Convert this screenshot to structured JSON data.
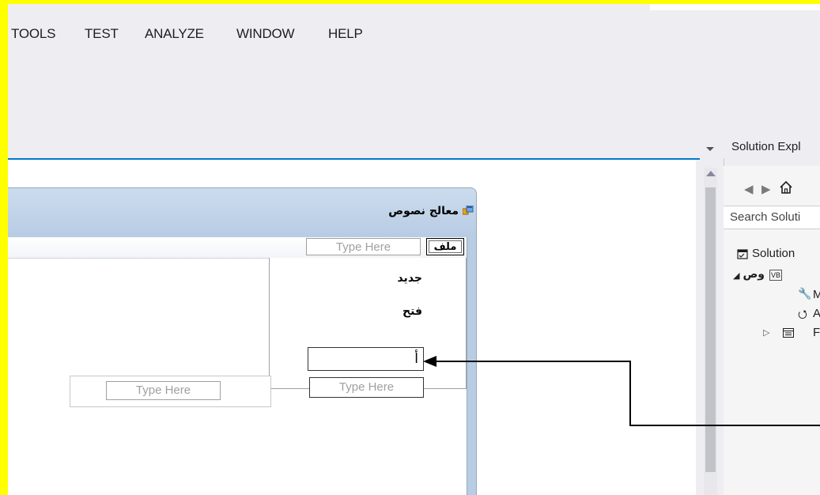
{
  "menu": {
    "items": [
      "TOOLS",
      "TEST",
      "ANALYZE",
      "WINDOW",
      "HELP"
    ]
  },
  "form": {
    "title": "معالج نصوص",
    "menu_file": "ملف",
    "type_here": "Type Here",
    "dropdown": {
      "new": "جديد",
      "open": "فتح",
      "edit_value": "أ",
      "type_here": "Type Here"
    },
    "submenu_type_here": "Type Here"
  },
  "solution_explorer": {
    "title": "Solution Expl",
    "search_placeholder": "Search Soluti",
    "tree": {
      "solution": "Solution",
      "project": "وص",
      "project_badge": "VB",
      "child_m": "M",
      "child_a": "A",
      "child_f": "F"
    }
  },
  "colors": {
    "highlight_border": "#ffff00",
    "accent": "#007acc"
  }
}
